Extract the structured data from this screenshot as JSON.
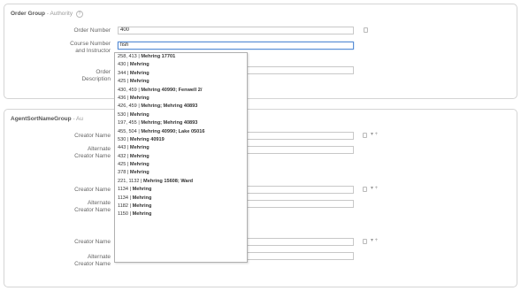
{
  "order_group": {
    "title": "Order Group",
    "subtitle": "- Authority",
    "help": "?",
    "order_number_label": "Order Number",
    "order_number_value": "400",
    "course_number_label": "Course Number\nand Instructor",
    "course_number_value": "fish",
    "order_description_label": "Order\nDescription",
    "order_description_value": ""
  },
  "agent_group": {
    "title": "AgentSortNameGroup",
    "subtitle": "- Au",
    "creators": [
      {
        "name_label": "Creator Name",
        "alt_label": "Alternate\nCreator Name",
        "name_value": "",
        "alt_value": ""
      },
      {
        "name_label": "Creator Name",
        "alt_label": "Alternate\nCreator Name",
        "name_value": "",
        "alt_value": ""
      },
      {
        "name_label": "Creator Name",
        "alt_label": "Alternate\nCreator Name",
        "name_value": "",
        "alt_value": ""
      }
    ],
    "row_controls": "▾ +"
  },
  "autocomplete": {
    "items": [
      {
        "code": "258, 413 |",
        "desc": "Mehring 17701"
      },
      {
        "code": "430 |",
        "desc": "Mehring"
      },
      {
        "code": "344 |",
        "desc": "Mehring"
      },
      {
        "code": "425 |",
        "desc": "Mehring"
      },
      {
        "code": "430, 459 |",
        "desc": "Mehring 40990; Fenwell 2/"
      },
      {
        "code": "436 |",
        "desc": "Mehring"
      },
      {
        "code": "426, 459 |",
        "desc": "Mehring; Mehring 40893"
      },
      {
        "code": "530 |",
        "desc": "Mehring"
      },
      {
        "code": "197, 455 |",
        "desc": "Mehring; Mehring 40893"
      },
      {
        "code": "455, 504 |",
        "desc": "Mehring 40990; Lake 05016"
      },
      {
        "code": "530 |",
        "desc": "Mehring 40919"
      },
      {
        "code": "443 |",
        "desc": "Mehring"
      },
      {
        "code": "432 |",
        "desc": "Mehring"
      },
      {
        "code": "425 |",
        "desc": "Mehring"
      },
      {
        "code": "378 |",
        "desc": "Mehring"
      },
      {
        "code": "221, 1132 |",
        "desc": "Mehring 15608; Ward"
      },
      {
        "code": "1134 |",
        "desc": "Mehring"
      },
      {
        "code": "1134 |",
        "desc": "Mehring"
      },
      {
        "code": "1182 |",
        "desc": "Mehring"
      },
      {
        "code": "1150 |",
        "desc": "Mehring"
      }
    ]
  }
}
